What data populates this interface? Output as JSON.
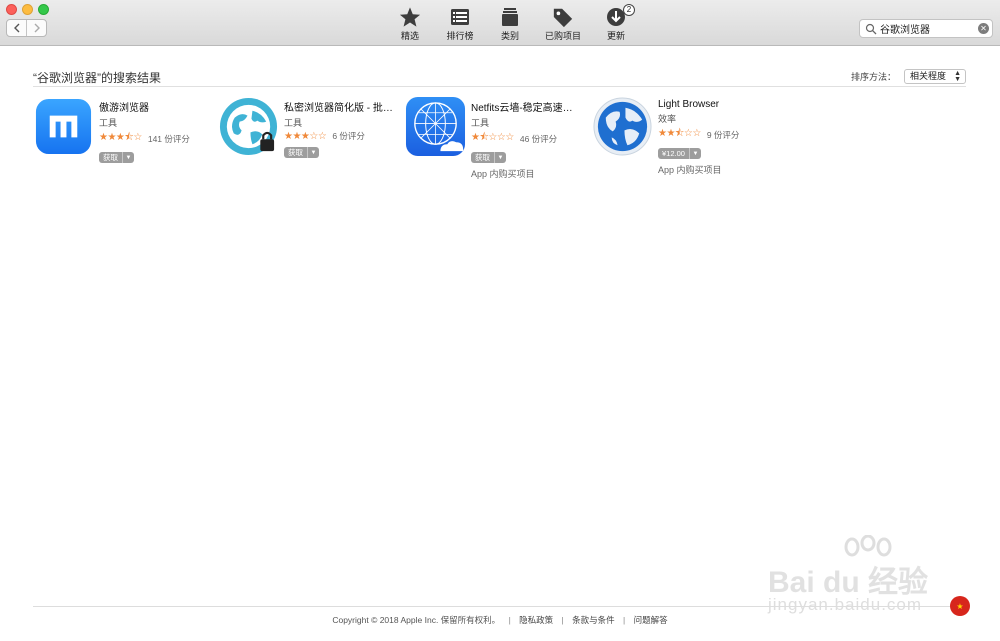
{
  "toolbar": {
    "tabs": [
      {
        "label": "精选",
        "icon": "star-icon"
      },
      {
        "label": "排行榜",
        "icon": "list-icon"
      },
      {
        "label": "类别",
        "icon": "category-icon"
      },
      {
        "label": "已购项目",
        "icon": "tag-icon"
      },
      {
        "label": "更新",
        "icon": "update-icon",
        "badge": "2"
      }
    ],
    "search": {
      "value": "谷歌浏览器",
      "placeholder": ""
    }
  },
  "results": {
    "title": "“谷歌浏览器”的搜索结果",
    "sort_label": "排序方法：",
    "sort_value": "相关程度"
  },
  "apps": [
    {
      "name": "傲游浏览器",
      "category": "工具",
      "stars": 3.5,
      "ratings": "141 份评分",
      "button": "获取",
      "iap": "",
      "icon": "maxthon-icon"
    },
    {
      "name": "私密浏览器简化版 - 批…",
      "category": "工具",
      "stars": 3,
      "ratings": "6 份评分",
      "button": "获取",
      "iap": "",
      "icon": "private-browser-icon"
    },
    {
      "name": "Netfits云墙-稳定高速…",
      "category": "工具",
      "stars": 1.5,
      "ratings": "46 份评分",
      "button": "获取",
      "iap": "App 内购买项目",
      "icon": "netfits-icon"
    },
    {
      "name": "Light Browser",
      "category": "效率",
      "stars": 2.5,
      "ratings": "9 份评分",
      "button": "¥12.00",
      "iap": "App 内购买项目",
      "icon": "light-browser-icon"
    }
  ],
  "footer": {
    "copyright": "Copyright © 2018 Apple Inc. 保留所有权利。",
    "privacy": "隐私政策",
    "terms": "条款与条件",
    "faq": "问题解答",
    "sep": "|"
  },
  "watermark": {
    "text": "Bai du 经验",
    "url": "jingyan.baidu.com"
  },
  "colors": {
    "star": "#f0893a",
    "accent_blue": "#1a73e8"
  }
}
